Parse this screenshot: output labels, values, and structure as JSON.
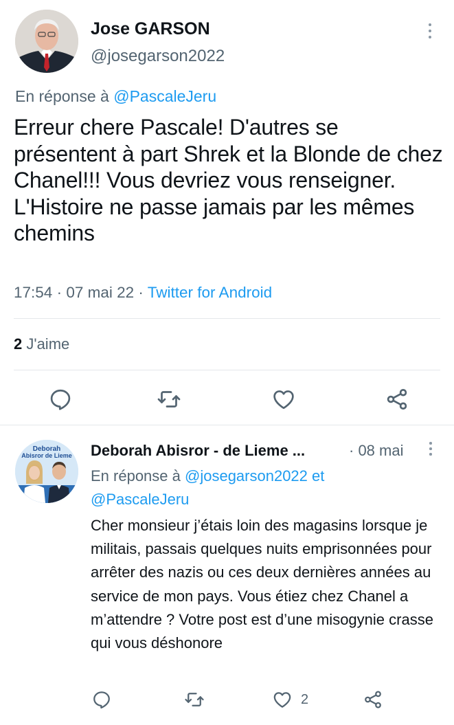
{
  "main_tweet": {
    "author_name": "Jose GARSON",
    "handle": "@josegarson2022",
    "reply_prefix": "En réponse à",
    "reply_to": "@PascaleJeru",
    "text": "Erreur chere Pascale! D'autres se présentent à part Shrek et la Blonde de chez Chanel!!! Vous devriez vous renseigner. L'Histoire ne passe jamais par les mêmes chemins",
    "time": "17:54",
    "dot": "·",
    "date": "07 mai 22",
    "source": "Twitter for Android",
    "likes_count": "2",
    "likes_label": "J'aime",
    "icons": [
      "reply-icon",
      "retweet-icon",
      "like-icon",
      "share-icon",
      "more-icon"
    ]
  },
  "reply_tweet": {
    "author_name": "Deborah Abisror - de Lieme ...",
    "date": "· 08 mai",
    "reply_prefix": "En réponse à",
    "reply_to_1": "@josegarson2022",
    "reply_and": "et",
    "reply_to_2": "@PascaleJeru",
    "text": "Cher monsieur j’étais loin des magasins lorsque je militais, passais quelques nuits emprisonnées pour arrêter des nazis ou ces deux dernières années au service de mon pays. Vous étiez chez Chanel a m’attendre ? Votre post est d’une misogynie crasse qui vous déshonore",
    "like_count": "2",
    "avatar_text_line1": "Deborah",
    "avatar_text_line2": "Abisror de Lieme",
    "icons": [
      "reply-icon",
      "retweet-icon",
      "like-icon",
      "share-icon",
      "more-icon"
    ]
  },
  "colors": {
    "accent": "#1d9bf0",
    "text": "#0f1419",
    "secondary": "#536471",
    "divider": "#e4e7ea"
  }
}
